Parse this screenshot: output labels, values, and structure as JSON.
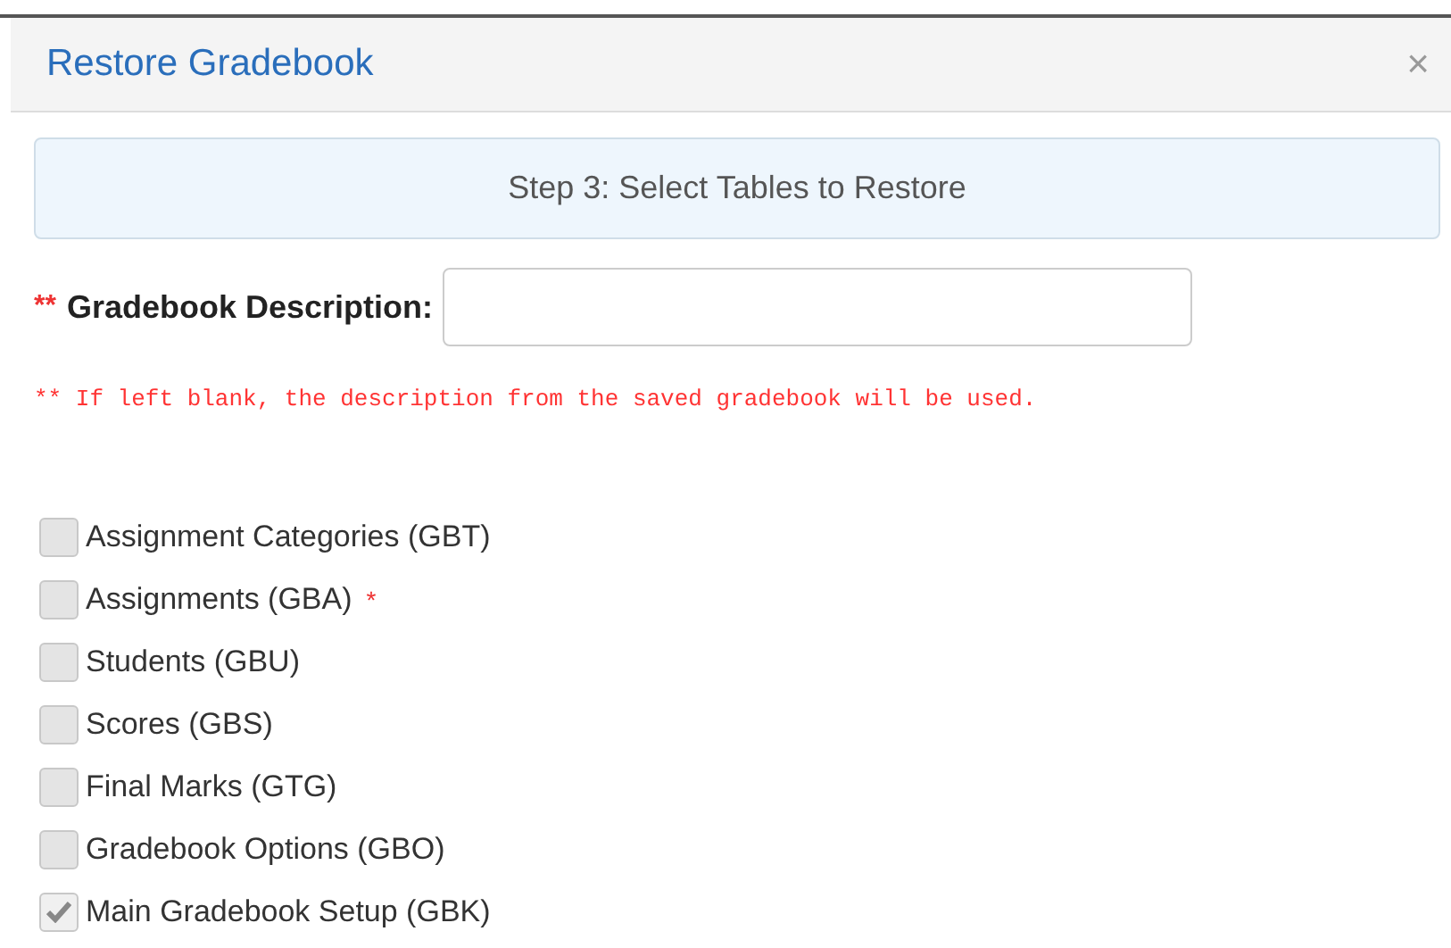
{
  "dialog": {
    "title": "Restore Gradebook",
    "close": "×"
  },
  "step": "Step 3: Select Tables to Restore",
  "description": {
    "required_mark": "**",
    "label": "Gradebook Description:"
  },
  "note": "** If left blank, the description from the saved gradebook will be used.",
  "tables": [
    {
      "label": "Assignment Categories (GBT)",
      "checked": false
    },
    {
      "label": "Assignments (GBA)",
      "checked": false,
      "marker": "*"
    },
    {
      "label": "Students (GBU)",
      "checked": false
    },
    {
      "label": "Scores (GBS)",
      "checked": false
    },
    {
      "label": "Final Marks (GTG)",
      "checked": false
    },
    {
      "label": "Gradebook Options (GBO)",
      "checked": false
    },
    {
      "label": "Main Gradebook Setup (GBK)",
      "checked": true
    }
  ]
}
